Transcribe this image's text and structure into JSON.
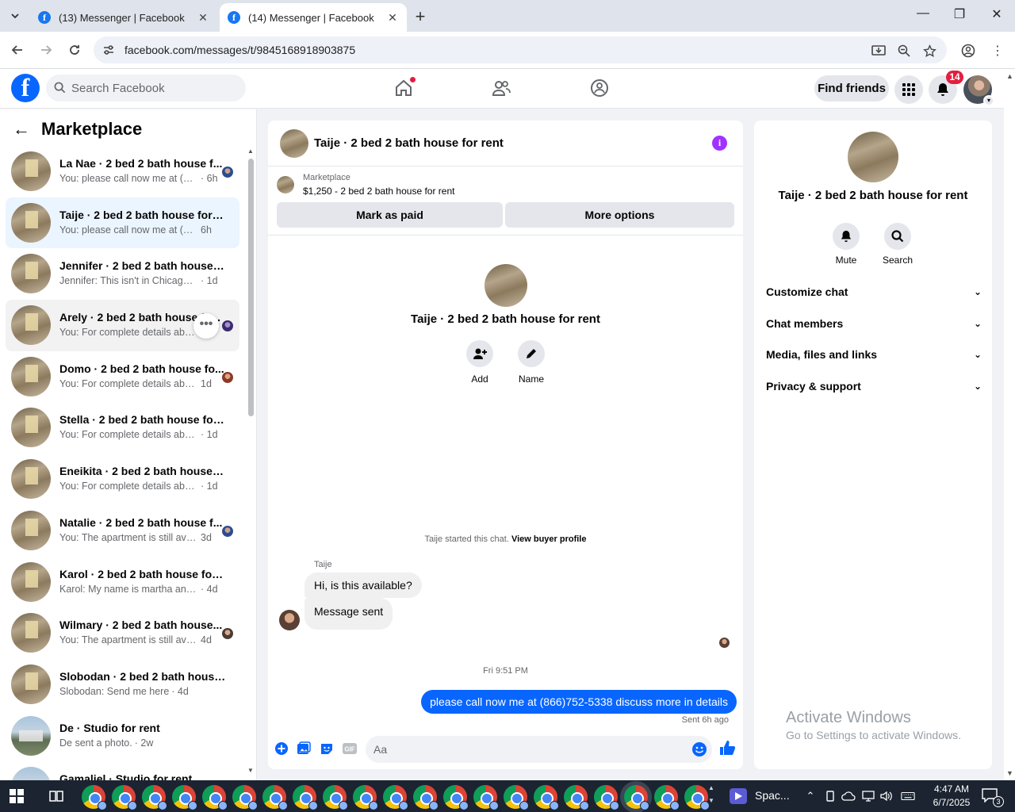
{
  "browser": {
    "tabs": [
      {
        "title": "(13) Messenger | Facebook",
        "active": false
      },
      {
        "title": "(14) Messenger | Facebook",
        "active": true
      }
    ],
    "url": "facebook.com/messages/t/9845168918903875"
  },
  "fb_header": {
    "search_placeholder": "Search Facebook",
    "find_friends": "Find friends",
    "notification_count": "14"
  },
  "left_panel": {
    "title": "Marketplace",
    "conversations": [
      {
        "name": "La Nae · 2 bed 2 bath house f...",
        "preview": "You: please call now me at (866)...",
        "time": "· 6h",
        "thumb": "house"
      },
      {
        "name": "Taije · 2 bed 2 bath house for rent",
        "preview": "You: please call now me at (866)75...",
        "time": "6h",
        "thumb": "house"
      },
      {
        "name": "Jennifer · 2 bed 2 bath house fo...",
        "preview": "Jennifer: This isn't in Chicago corre...",
        "time": "· 1d",
        "thumb": "house"
      },
      {
        "name": "Arely · 2 bed 2 bath house fo...",
        "preview": "You: For complete details about ...",
        "time": "",
        "thumb": "house"
      },
      {
        "name": "Domo · 2 bed 2 bath house fo...",
        "preview": "You: For complete details about ...",
        "time": "1d",
        "thumb": "house"
      },
      {
        "name": "Stella · 2 bed 2 bath house for r...",
        "preview": "You: For complete details about thi...",
        "time": "· 1d",
        "thumb": "house"
      },
      {
        "name": "Eneikita · 2 bed 2 bath house fo...",
        "preview": "You: For complete details about thi...",
        "time": "· 1d",
        "thumb": "house"
      },
      {
        "name": "Natalie · 2 bed 2 bath house f...",
        "preview": "You: The apartment is still availa...",
        "time": "3d",
        "thumb": "house"
      },
      {
        "name": "Karol · 2 bed 2 bath house for r...",
        "preview": "Karol: My name is martha and my ...",
        "time": "· 4d",
        "thumb": "house"
      },
      {
        "name": "Wilmary · 2 bed 2 bath house...",
        "preview": "You: The apartment is still availa...",
        "time": "4d",
        "thumb": "house"
      },
      {
        "name": "Slobodan · 2 bed 2 bath house f...",
        "preview": "Slobodan: Send me here",
        "time": "· 4d",
        "thumb": "house"
      },
      {
        "name": "De · Studio for rent",
        "preview": "De sent a photo.",
        "time": "· 2w",
        "thumb": "studio"
      },
      {
        "name": "Gamaliel · Studio for rent",
        "preview": "",
        "time": "",
        "thumb": "studio"
      }
    ]
  },
  "chat": {
    "title": "Taije · 2 bed 2 bath house for rent",
    "marketplace_label": "Marketplace",
    "listing": "$1,250 - 2 bed 2 bath house for rent",
    "mark_paid": "Mark as paid",
    "more_options": "More options",
    "center_name": "Taije · 2 bed 2 bath house for rent",
    "add_label": "Add",
    "name_label": "Name",
    "started_text": "Taije started this chat.",
    "view_buyer": "View buyer profile",
    "sender": "Taije",
    "msg1": "Hi, is this available?",
    "msg2": "Message sent",
    "timestamp": "Fri 9:51 PM",
    "outgoing": "please call now me at (866)752-5338 discuss more in details",
    "sent_status": "Sent 6h ago",
    "composer_placeholder": "Aa"
  },
  "info_panel": {
    "name": "Taije · 2 bed 2 bath house for rent",
    "mute": "Mute",
    "search": "Search",
    "sections": [
      "Customize chat",
      "Chat members",
      "Media, files and links",
      "Privacy & support"
    ]
  },
  "watermark": {
    "line1": "Activate Windows",
    "line2": "Go to Settings to activate Windows."
  },
  "taskbar": {
    "app_label": "Spac...",
    "time": "4:47 AM",
    "date": "6/7/2025",
    "notif_count": "3"
  }
}
